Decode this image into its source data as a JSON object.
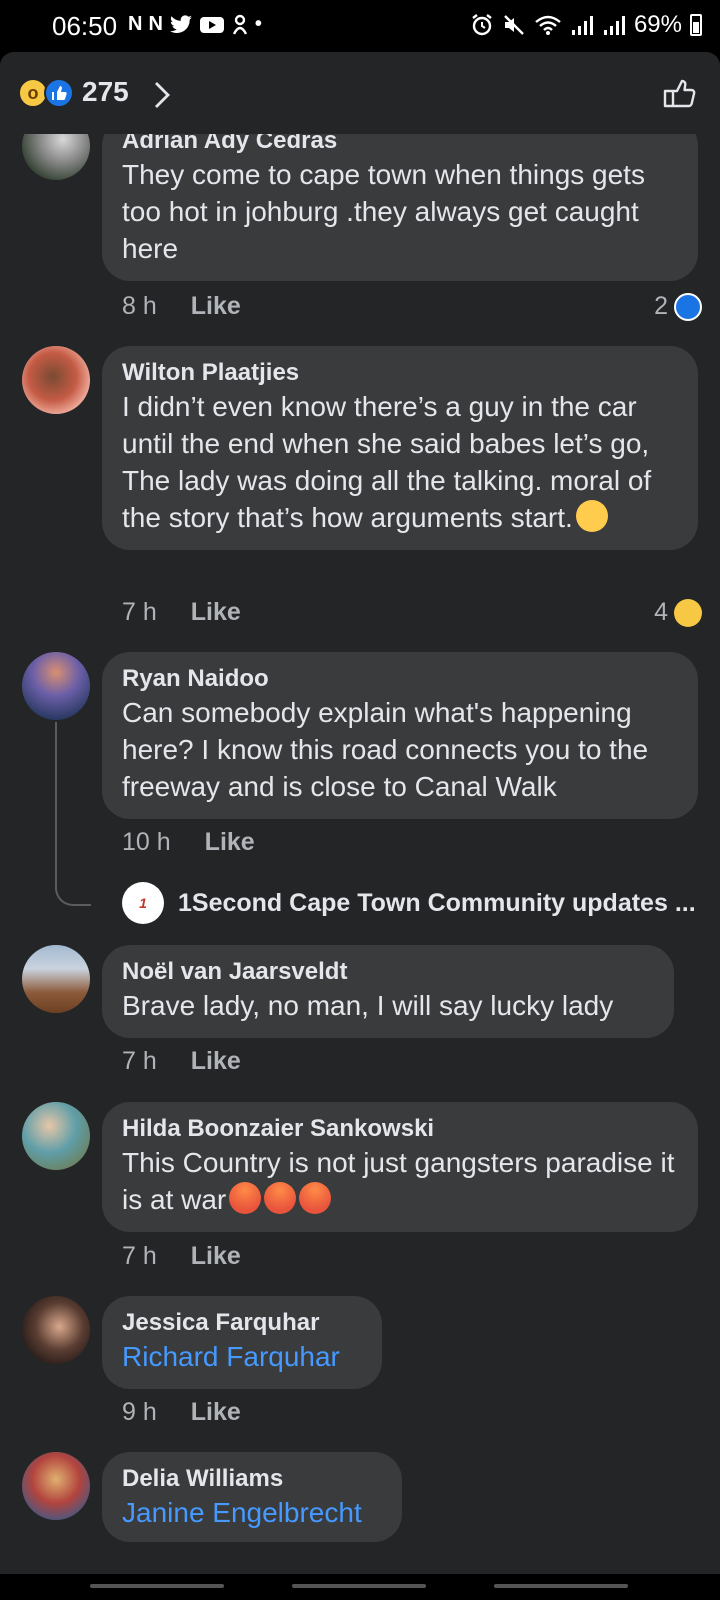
{
  "status_bar": {
    "time": "06:50",
    "notification_icons": [
      "N",
      "N",
      "twitter-icon",
      "youtube-icon",
      "app-icon",
      "•"
    ],
    "battery": "69%"
  },
  "header": {
    "reaction_count": "275"
  },
  "comments": [
    {
      "author": "Adrian Ady Cedras",
      "text": "They come to cape town when things gets too hot in johburg .they always get caught here",
      "time": "8 h",
      "like": "Like",
      "reaction_count": "2"
    },
    {
      "author": "Wilton Plaatjies",
      "text": "I didn’t even know there’s a guy in the car until the end when she said babes let’s go, The lady was doing all the talking. moral of the story that’s how arguments start.",
      "time": "7 h",
      "like": "Like",
      "reaction_count": "4"
    },
    {
      "author": "Ryan Naidoo",
      "text": "Can somebody explain what's happening here? I know this road connects you to the freeway and is close to Canal Walk",
      "time": "10 h",
      "like": "Like",
      "reply_author": "1Second Cape Town Community updates ..."
    },
    {
      "author": "Noël van Jaarsveldt",
      "text": "Brave lady, no man, I will say lucky lady",
      "time": "7 h",
      "like": "Like"
    },
    {
      "author": "Hilda Boonzaier Sankowski",
      "text": "This Country is not just gangsters paradise it is at war",
      "time": "7 h",
      "like": "Like"
    },
    {
      "author": "Jessica Farquhar",
      "tag": "Richard Farquhar",
      "time": "9 h",
      "like": "Like"
    },
    {
      "author": "Delia Williams",
      "tag": "Janine Engelbrecht"
    }
  ],
  "colors": {
    "background": "#242526",
    "bubble": "#3a3b3c",
    "link": "#4599ff",
    "like_blue": "#1b74e4"
  }
}
